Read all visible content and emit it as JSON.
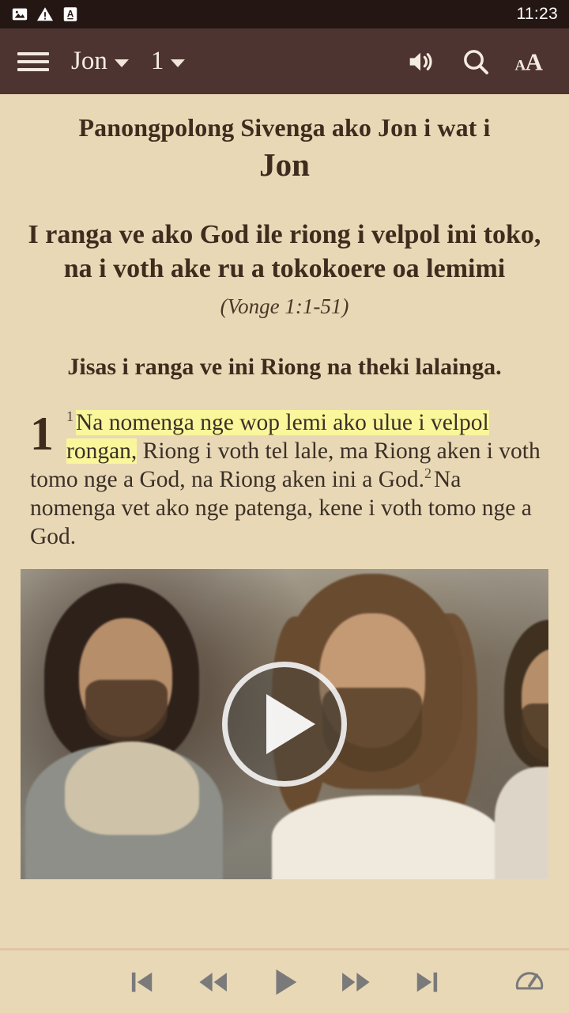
{
  "status_bar": {
    "icons": [
      "image-icon",
      "warning-icon",
      "letter-a-box-icon"
    ],
    "clock": "11:23"
  },
  "toolbar": {
    "menu_icon": "hamburger-menu-icon",
    "book_label": "Jon",
    "chapter_label": "1",
    "audio_icon": "speaker-volume-icon",
    "search_icon": "search-icon",
    "text_size_icon": "text-size-icon"
  },
  "content": {
    "book_intro": "Panongpolong Sivenga ako Jon i wat i",
    "book_title": "Jon",
    "section_heading": "I ranga ve ako God ile riong i velpol ini toko, na i voth ake ru a tokokoere oa lemimi",
    "section_reference": "(Vonge 1:1-51)",
    "sub_heading": "Jisas i ranga ve ini Riong na theki lalainga.",
    "chapter_number": "1",
    "verses": [
      {
        "number": "1",
        "highlighted_text": "Na nomenga nge wop lemi ako ulue i velpol rongan,",
        "rest_text": " Riong i voth tel lale, ma Riong aken i voth tomo nge a God, na Riong aken ini a God."
      },
      {
        "number": "2",
        "highlighted_text": "",
        "rest_text": "Na nomenga vet ako nge patenga, kene i voth tomo nge a God."
      }
    ]
  },
  "video": {
    "play_icon": "play-button-icon",
    "alt": "Jesus speaking with disciples"
  },
  "player": {
    "skip_previous_icon": "skip-previous-icon",
    "rewind_icon": "rewind-icon",
    "play_icon": "play-icon",
    "fast_forward_icon": "fast-forward-icon",
    "skip_next_icon": "skip-next-icon",
    "speed_icon": "playback-speed-gauge-icon"
  },
  "colors": {
    "page_background": "#e9d8b6",
    "toolbar": "#4e3430",
    "status_bar": "#241713",
    "text": "#3f2c1e",
    "highlight": "#faf69b",
    "player_icon": "#7a7a7a"
  }
}
